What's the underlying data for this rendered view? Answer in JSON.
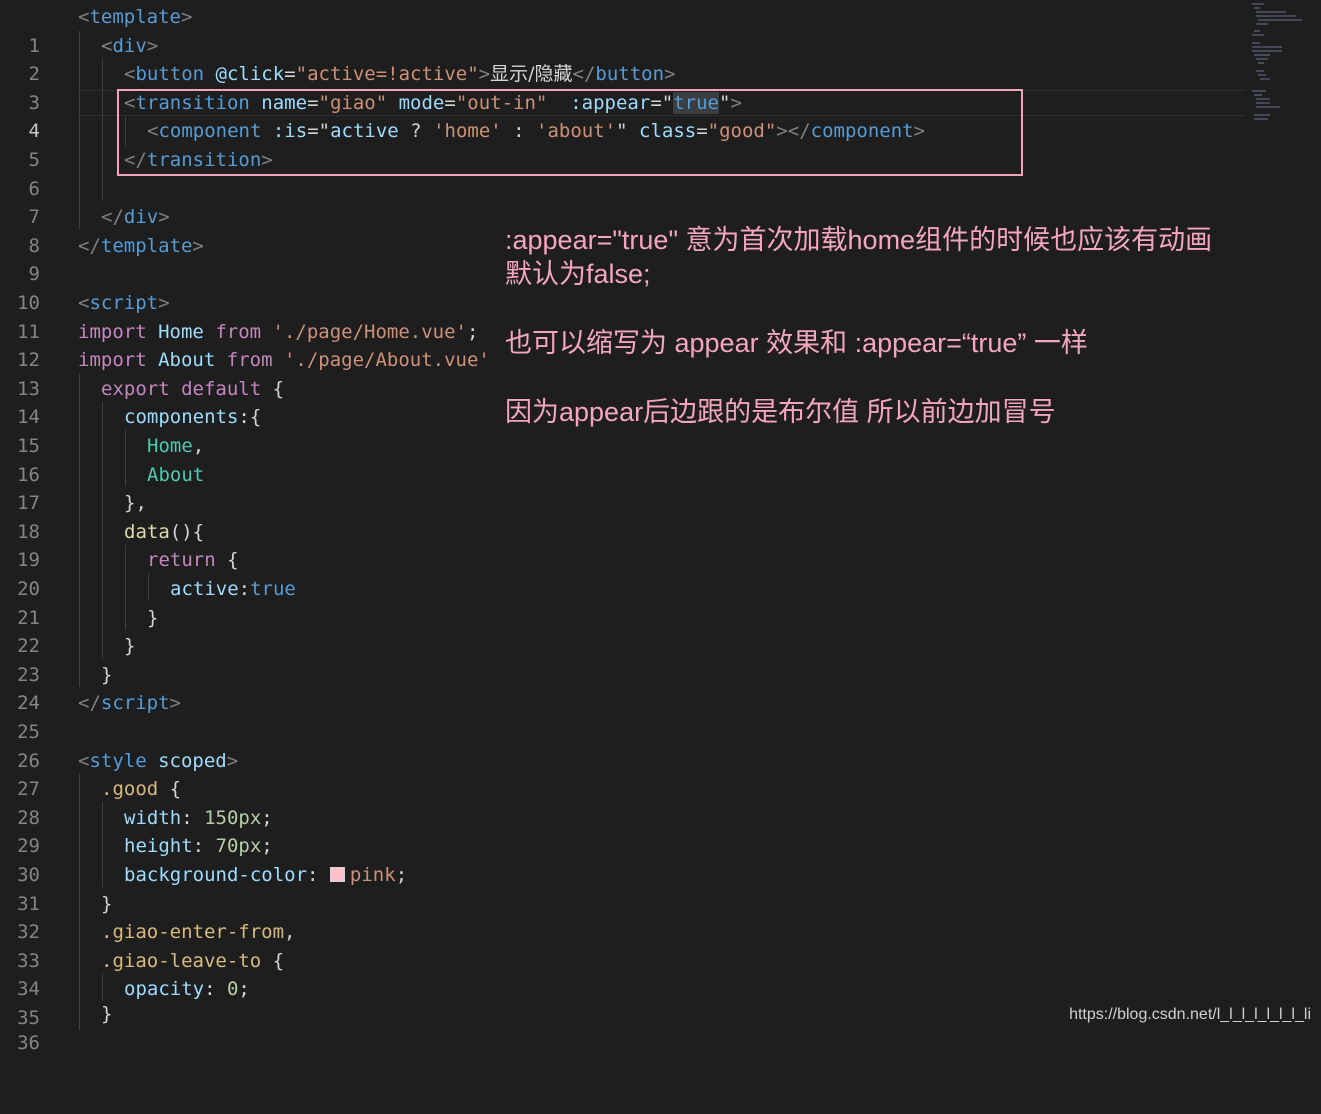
{
  "editor": {
    "line_numbers": [
      "1",
      "2",
      "3",
      "4",
      "5",
      "6",
      "7",
      "8",
      "9",
      "10",
      "11",
      "12",
      "13",
      "14",
      "15",
      "16",
      "17",
      "18",
      "19",
      "20",
      "21",
      "22",
      "23",
      "24",
      "25",
      "26",
      "27",
      "28",
      "29",
      "30",
      "31",
      "32",
      "33",
      "34",
      "35",
      "36"
    ],
    "active_line": "4",
    "code_lines": {
      "l1": {
        "lt": "<",
        "tag": "template",
        "gt": ">"
      },
      "l2": {
        "lt": "<",
        "tag": "div",
        "gt": ">"
      },
      "l3": {
        "lt": "<",
        "tag": "button",
        "attr": "@click",
        "eq": "=",
        "val": "\"active=!active\"",
        "gt": ">",
        "text": "显示/隐藏",
        "close_lt": "</",
        "close_tag": "button",
        "close_gt": ">"
      },
      "l4": {
        "lt": "<",
        "tag": "transition",
        "a1": "name",
        "v1": "\"giao\"",
        "a2": "mode",
        "v2": "\"out-in\"",
        "a3": ":appear",
        "eq": "=",
        "q1": "\"",
        "v3": "true",
        "q2": "\"",
        "gt": ">"
      },
      "l5": {
        "lt": "<",
        "tag": "component",
        "a1": ":is",
        "eq": "=",
        "q1": "\"",
        "v1": "active",
        "op1": " ? ",
        "s1": "'home'",
        "op2": " : ",
        "s2": "'about'",
        "q2": "\"",
        "a2": "class",
        "v2": "\"good\"",
        "gt": "></",
        "close_tag": "component",
        "close_gt": ">"
      },
      "l6": {
        "lt": "</",
        "tag": "transition",
        "gt": ">"
      },
      "l8": {
        "lt": "</",
        "tag": "div",
        "gt": ">"
      },
      "l9": {
        "lt": "</",
        "tag": "template",
        "gt": ">"
      },
      "l11": {
        "lt": "<",
        "tag": "script",
        "gt": ">"
      },
      "l12": {
        "kw": "import",
        "name": "Home",
        "kw2": "from",
        "str": "'./page/Home.vue'",
        "end": ";"
      },
      "l13": {
        "kw": "import",
        "name": "About",
        "kw2": "from",
        "str": "'./page/About.vue'"
      },
      "l14": {
        "kw": "export default",
        "end": " {"
      },
      "l15": {
        "prop": "components",
        "end": ":{"
      },
      "l16": {
        "name": "Home",
        "end": ","
      },
      "l17": {
        "name": "About"
      },
      "l18": {
        "text": "},"
      },
      "l19": {
        "func": "data",
        "end": "(){"
      },
      "l20": {
        "kw": "return",
        "end": " {"
      },
      "l21": {
        "prop": "active",
        "colon": ":",
        "val": "true"
      },
      "l22": {
        "text": "}"
      },
      "l23": {
        "text": "}"
      },
      "l24": {
        "text": "}"
      },
      "l25": {
        "lt": "</",
        "tag": "script",
        "gt": ">"
      },
      "l27": {
        "lt": "<",
        "tag": "style",
        "attr": "scoped",
        "gt": ">"
      },
      "l28": {
        "sel": ".good",
        "end": " {"
      },
      "l29": {
        "prop": "width",
        "colon": ": ",
        "num": "150px",
        "end": ";"
      },
      "l30": {
        "prop": "height",
        "colon": ": ",
        "num": "70px",
        "end": ";"
      },
      "l31": {
        "prop": "background-color",
        "colon": ": ",
        "val": "pink",
        "end": ";",
        "swatch_color": "#ffc0cb"
      },
      "l32": {
        "text": "}"
      },
      "l33": {
        "sel": ".giao-enter-from",
        "end": ","
      },
      "l34": {
        "sel": ".giao-leave-to",
        "end": " {"
      },
      "l35": {
        "prop": "opacity",
        "colon": ": ",
        "num": "0",
        "end": ";"
      },
      "l36": {
        "text": "}"
      }
    }
  },
  "notes": {
    "n1": ":appear=\"true\" 意为首次加载home组件的时候也应该有动画",
    "n2": "默认为false;",
    "n3": "也可以缩写为 appear 效果和 :appear=“true” 一样",
    "n4": "因为appear后边跟的是布尔值 所以前边加冒号"
  },
  "watermark": "https://blog.csdn.net/l_l_l_l_l_l_l_li",
  "colors": {
    "background": "#1e1e1e",
    "annotation": "#f4a6bc",
    "highlight_box": "#f0a6b6"
  }
}
